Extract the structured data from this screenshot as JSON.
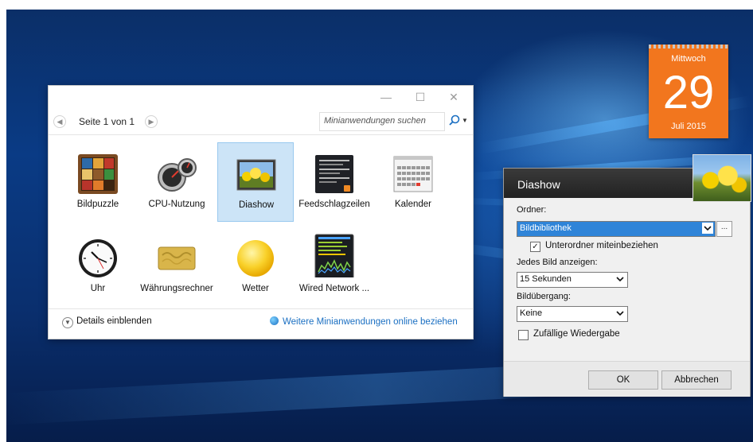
{
  "gallery": {
    "window_controls": {
      "minimize": "—",
      "maximize": "☐",
      "close": "✕"
    },
    "page_label": "Seite 1 von 1",
    "search_placeholder": "Minianwendungen suchen",
    "gadgets": [
      {
        "label": "Bildpuzzle",
        "icon": "picture-puzzle-icon",
        "selected": false
      },
      {
        "label": "CPU-Nutzung",
        "icon": "cpu-meter-icon",
        "selected": false
      },
      {
        "label": "Diashow",
        "icon": "slideshow-icon",
        "selected": true
      },
      {
        "label": "Feedschlagzeilen",
        "icon": "feed-headlines-icon",
        "selected": false
      },
      {
        "label": "Kalender",
        "icon": "calendar-icon",
        "selected": false
      },
      {
        "label": "Uhr",
        "icon": "clock-icon",
        "selected": false
      },
      {
        "label": "Währungsrechner",
        "icon": "currency-icon",
        "selected": false
      },
      {
        "label": "Wetter",
        "icon": "weather-sun-icon",
        "selected": false
      },
      {
        "label": "Wired Network ...",
        "icon": "network-meter-icon",
        "selected": false
      }
    ],
    "details_label": "Details einblenden",
    "online_link": "Weitere Minianwendungen online beziehen"
  },
  "calendar_gadget": {
    "weekday": "Mittwoch",
    "day": "29",
    "month_year": "Juli 2015",
    "color": "#f2761e"
  },
  "dialog": {
    "title": "Diashow",
    "folder_label": "Ordner:",
    "folder_value": "Bildbibliothek",
    "browse_label": "...",
    "subfolders_label": "Unterordner miteinbeziehen",
    "subfolders_checked": true,
    "interval_label": "Jedes Bild anzeigen:",
    "interval_value": "15 Sekunden",
    "transition_label": "Bildübergang:",
    "transition_value": "Keine",
    "shuffle_label": "Zufällige Wiedergabe",
    "shuffle_checked": false,
    "ok_label": "OK",
    "cancel_label": "Abbrechen",
    "accent": "#2f84d8"
  }
}
